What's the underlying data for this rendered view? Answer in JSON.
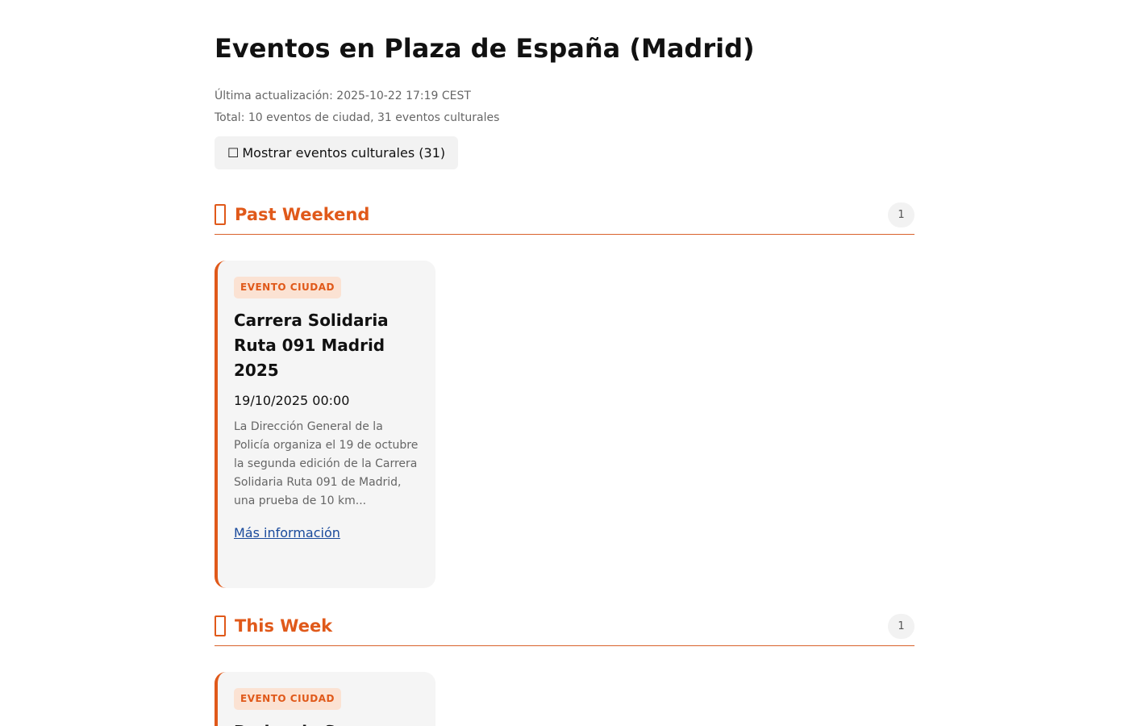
{
  "header": {
    "title": "Eventos en Plaza de España (Madrid)",
    "last_updated": "Última actualización: 2025-10-22 17:19 CEST",
    "total": "Total: 10 eventos de ciudad, 31 eventos culturales"
  },
  "toggle": {
    "checkbox_glyph": "☐",
    "label": "Mostrar eventos culturales (31)"
  },
  "sections": [
    {
      "icon": "calendar-icon",
      "title": "Past Weekend",
      "count": "1",
      "events": [
        {
          "badge": "EVENTO CIUDAD",
          "title": "Carrera Solidaria Ruta 091 Madrid 2025",
          "date": "19/10/2025 00:00",
          "description": "La Dirección General de la Policía organiza el 19 de octubre la segunda edición de la Carrera Solidaria Ruta 091 de Madrid, una prueba de 10 km...",
          "link": "Más información"
        }
      ]
    },
    {
      "icon": "calendar-icon",
      "title": "This Week",
      "count": "1",
      "events": [
        {
          "badge": "EVENTO CIUDAD",
          "title": "Dadas de S..."
        }
      ]
    }
  ],
  "colors": {
    "accent": "#e0591a",
    "badge_bg": "#fbe2d3",
    "link": "#1a4a9c",
    "card_bg": "#f5f5f5"
  }
}
